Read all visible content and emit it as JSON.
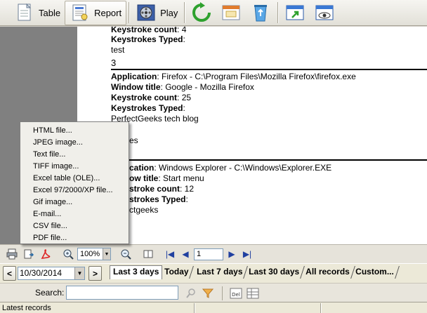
{
  "toolbar": {
    "table_label": "Table",
    "report_label": "Report",
    "play_label": "Play",
    "icons": [
      "table-icon",
      "report-icon",
      "film-reel-icon",
      "refresh-icon",
      "calendar-window-icon",
      "recycle-bin-icon",
      "window-arrow-icon",
      "eye-window-icon"
    ]
  },
  "report": {
    "entries": [
      {
        "keystroke_count_label": "Keystroke count",
        "keystroke_count": ": 4",
        "keystrokes_typed_label": "Keystrokes Typed",
        "typed_lines": [
          "test"
        ],
        "index": "3"
      },
      {
        "application_label": "Application",
        "application": ": Firefox - C:\\Program Files\\Mozilla Firefox\\firefox.exe",
        "window_title_label": "Window title",
        "window_title": ": Google - Mozilla Firefox",
        "keystroke_count_label": "Keystroke count",
        "keystroke_count": ": 25",
        "keystrokes_typed_label": "Keystrokes Typed",
        "typed_lines": [
          "PerfectGeeks tech blog",
          "es"
        ]
      },
      {
        "application_label": "cation",
        "application": ": Windows Explorer - C:\\Windows\\Explorer.EXE",
        "window_title_label": "ow title",
        "window_title": ": Start menu",
        "keystroke_count_label": "stroke count",
        "keystroke_count": ": 12",
        "keystrokes_typed_label": "strokes Typed",
        "typed_lines": [
          "ctgeeks"
        ]
      }
    ]
  },
  "export_menu": {
    "items": [
      "HTML file...",
      "JPEG image...",
      "Text file...",
      "TIFF image...",
      "Excel table (OLE)...",
      "Excel 97/2000/XP file...",
      "Gif image...",
      "E-mail...",
      "CSV file...",
      "PDF file..."
    ]
  },
  "preview_toolbar": {
    "zoom": "100%",
    "page": "1",
    "icons": [
      "print-icon",
      "export-icon",
      "pdf-icon",
      "zoom-in-icon",
      "zoom-out-icon",
      "book-icon",
      "first-page-icon",
      "prev-page-icon",
      "next-page-icon",
      "last-page-icon"
    ]
  },
  "date_filter": {
    "date": "10/30/2014",
    "tabs": [
      "Last 3 days",
      "Today",
      "Last 7 days",
      "Last 30 days",
      "All records",
      "Custom..."
    ],
    "selected_tab": 0
  },
  "search": {
    "label": "Search:",
    "value": ""
  },
  "status": {
    "text": "Latest records"
  }
}
